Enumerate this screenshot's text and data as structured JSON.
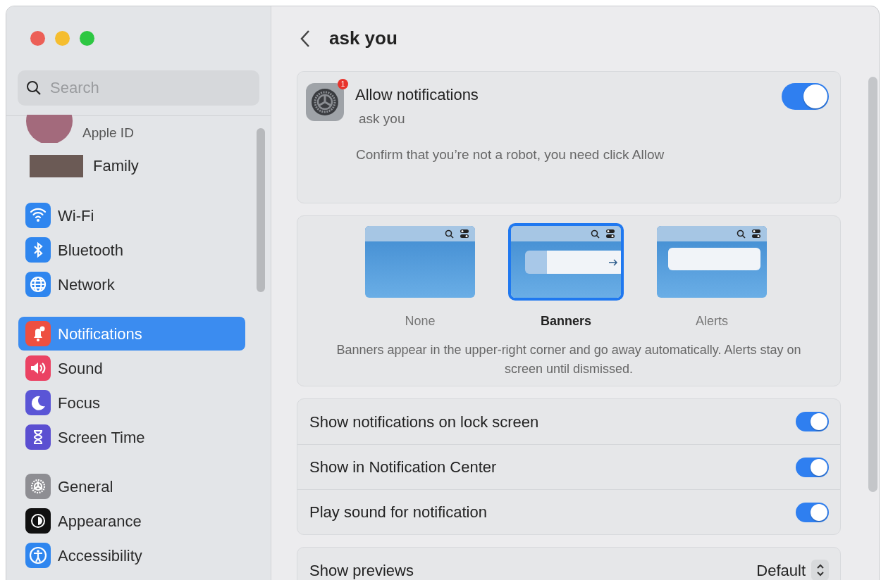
{
  "sidebar": {
    "search": {
      "placeholder": "Search"
    },
    "account": {
      "subtitle": "Apple ID"
    },
    "family": {
      "label": "Family"
    },
    "groups": [
      [
        {
          "label": "Wi-Fi",
          "color": "#2f86ef",
          "selected": false
        },
        {
          "label": "Bluetooth",
          "color": "#2f86ef",
          "selected": false
        },
        {
          "label": "Network",
          "color": "#2f86ef",
          "selected": false
        }
      ],
      [
        {
          "label": "Notifications",
          "color": "#ee4f41",
          "selected": true
        },
        {
          "label": "Sound",
          "color": "#eb4263",
          "selected": false
        },
        {
          "label": "Focus",
          "color": "#5a55d6",
          "selected": false
        },
        {
          "label": "Screen Time",
          "color": "#5b4fd1",
          "selected": false
        }
      ],
      [
        {
          "label": "General",
          "color": "#8e8e93",
          "selected": false
        },
        {
          "label": "Appearance",
          "color": "#111111",
          "selected": false
        },
        {
          "label": "Accessibility",
          "color": "#2f86ef",
          "selected": false
        }
      ]
    ]
  },
  "header": {
    "title": "ask you"
  },
  "app": {
    "title": "Allow notifications",
    "subtitle": "ask you",
    "badge": "1",
    "on": true,
    "note": "Confirm that you’re not a robot, you need click Allow"
  },
  "styles": [
    {
      "kind": "none",
      "label": "None",
      "selected": false
    },
    {
      "kind": "banner",
      "label": "Banners",
      "selected": true
    },
    {
      "kind": "alert",
      "label": "Alerts",
      "selected": false
    }
  ],
  "styles_note": "Banners appear in the upper-right corner and go away automatically. Alerts stay on screen until dismissed.",
  "toggles": [
    {
      "label": "Show notifications on lock screen",
      "on": true
    },
    {
      "label": "Show in Notification Center",
      "on": true
    },
    {
      "label": "Play sound for notification",
      "on": true
    }
  ],
  "previews": {
    "label": "Show previews",
    "value": "Default"
  }
}
